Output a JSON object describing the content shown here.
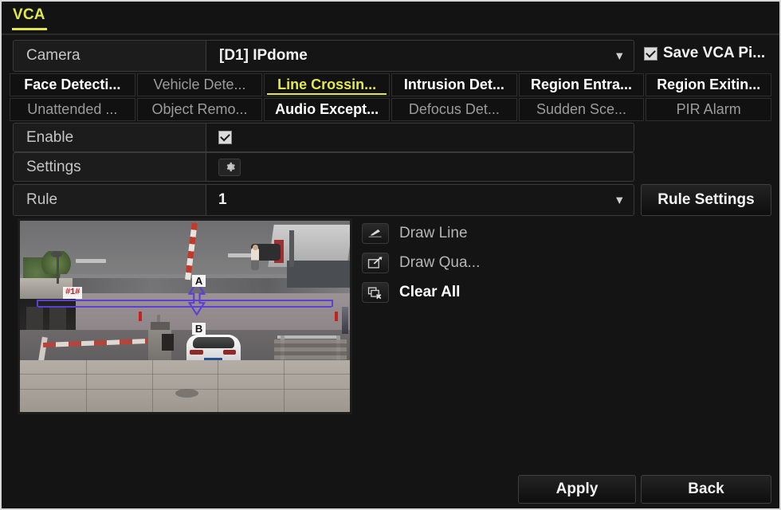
{
  "window": {
    "title": "VCA"
  },
  "camera": {
    "label": "Camera",
    "value": "[D1] IPdome",
    "caret": "chevron-down-icon"
  },
  "save_vca": {
    "label": "Save VCA Pi...",
    "checked": true
  },
  "tabs": {
    "row1": [
      {
        "label": "Face Detecti...",
        "state": "on"
      },
      {
        "label": "Vehicle Dete...",
        "state": "off"
      },
      {
        "label": "Line Crossin...",
        "state": "selected"
      },
      {
        "label": "Intrusion Det...",
        "state": "on"
      },
      {
        "label": "Region Entra...",
        "state": "on"
      },
      {
        "label": "Region Exitin...",
        "state": "on"
      }
    ],
    "row2": [
      {
        "label": "Unattended ...",
        "state": "off"
      },
      {
        "label": "Object Remo...",
        "state": "off"
      },
      {
        "label": "Audio Except...",
        "state": "on"
      },
      {
        "label": "Defocus Det...",
        "state": "off"
      },
      {
        "label": "Sudden Sce...",
        "state": "off"
      },
      {
        "label": "PIR Alarm",
        "state": "off"
      }
    ]
  },
  "fields": {
    "enable": {
      "label": "Enable",
      "checked": true
    },
    "settings": {
      "label": "Settings",
      "icon": "gear-icon"
    },
    "rule": {
      "label": "Rule",
      "value": "1",
      "caret": "chevron-down-icon"
    }
  },
  "buttons": {
    "rule_settings": "Rule Settings",
    "apply": "Apply",
    "back": "Back"
  },
  "tools": [
    {
      "label": "Draw Line",
      "icon": "pencil-line-icon",
      "emphasis": "normal"
    },
    {
      "label": "Draw Qua...",
      "icon": "draw-quad-icon",
      "emphasis": "normal"
    },
    {
      "label": "Clear All",
      "icon": "clear-all-icon",
      "emphasis": "strong"
    }
  ],
  "preview": {
    "rule_tag": "#1#",
    "direction_a": "A",
    "direction_b": "B"
  },
  "colors": {
    "accent": "#e2e84a",
    "panel": "#1c1c1c",
    "background": "#141414",
    "text": "#f2f2f2",
    "muted": "#9b9b9b",
    "line_overlay": "#5b3fd6",
    "rule_tag_text": "#d01818"
  }
}
